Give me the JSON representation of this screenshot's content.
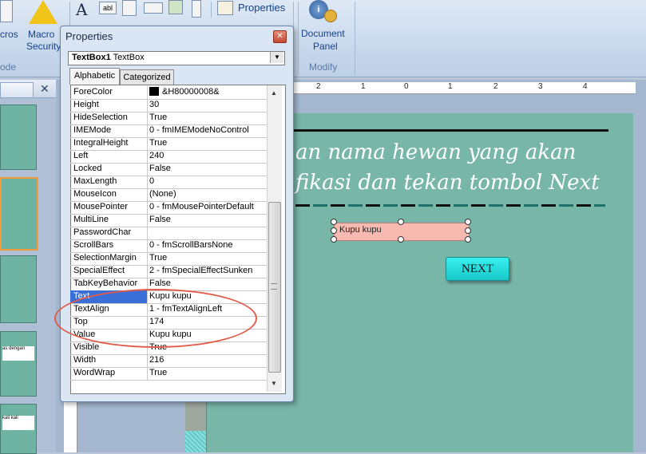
{
  "ribbon": {
    "macros_label": "cros",
    "macro_security_line1": "Macro",
    "macro_security_line2": "Security",
    "code_group_label": "ode",
    "properties_label": "Properties",
    "document_panel_line1": "Document",
    "document_panel_line2": "Panel",
    "modify_group_label": "Modify"
  },
  "left_panel": {
    "close_glyph": "✕",
    "thumb_texts": [
      "",
      "",
      "",
      "as dengan",
      "kali kali"
    ]
  },
  "ruler": {
    "ticks": [
      "2",
      "1",
      "0",
      "1",
      "2",
      "3",
      "4"
    ]
  },
  "slide": {
    "line1": "an nama hewan yang akan",
    "line2": "fikasi dan tekan tombol Next",
    "textbox_value": "Kupu kupu",
    "next_label": "NEXT",
    "accent_color": "#78b6a8",
    "textbox_color": "#f8b9b0"
  },
  "properties": {
    "title": "Properties",
    "close_glyph": "✕",
    "object_name": "TextBox1",
    "object_type": "TextBox",
    "tabs": [
      {
        "label": "Alphabetic",
        "active": true
      },
      {
        "label": "Categorized",
        "active": false
      }
    ],
    "rows": [
      {
        "k": "ForeColor",
        "v": "&H80000008&",
        "swatch": true
      },
      {
        "k": "Height",
        "v": "30"
      },
      {
        "k": "HideSelection",
        "v": "True"
      },
      {
        "k": "IMEMode",
        "v": "0 - fmIMEModeNoControl"
      },
      {
        "k": "IntegralHeight",
        "v": "True"
      },
      {
        "k": "Left",
        "v": "240"
      },
      {
        "k": "Locked",
        "v": "False"
      },
      {
        "k": "MaxLength",
        "v": "0"
      },
      {
        "k": "MouseIcon",
        "v": "(None)"
      },
      {
        "k": "MousePointer",
        "v": "0 - fmMousePointerDefault"
      },
      {
        "k": "MultiLine",
        "v": "False"
      },
      {
        "k": "PasswordChar",
        "v": ""
      },
      {
        "k": "ScrollBars",
        "v": "0 - fmScrollBarsNone"
      },
      {
        "k": "SelectionMargin",
        "v": "True"
      },
      {
        "k": "SpecialEffect",
        "v": "2 - fmSpecialEffectSunken"
      },
      {
        "k": "TabKeyBehavior",
        "v": "False"
      },
      {
        "k": "Text",
        "v": "Kupu kupu",
        "selected": true
      },
      {
        "k": "TextAlign",
        "v": "1 - fmTextAlignLeft"
      },
      {
        "k": "Top",
        "v": "174"
      },
      {
        "k": "Value",
        "v": "Kupu kupu"
      },
      {
        "k": "Visible",
        "v": "True"
      },
      {
        "k": "Width",
        "v": "216"
      },
      {
        "k": "WordWrap",
        "v": "True"
      }
    ],
    "scroll_up": "▲",
    "scroll_down": "▼",
    "combo_arrow": "▼",
    "annotation_color": "#e25b4a"
  }
}
